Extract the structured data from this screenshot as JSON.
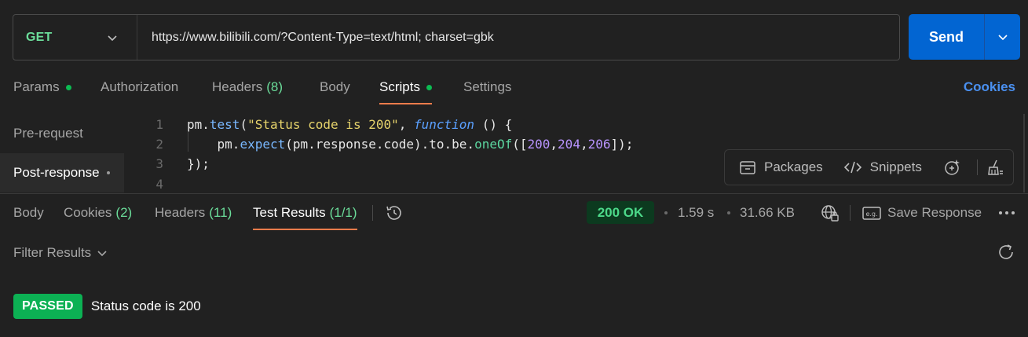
{
  "request": {
    "method": "GET",
    "url": "https://www.bilibili.com/?Content-Type=text/html; charset=gbk",
    "send_label": "Send"
  },
  "request_tabs": {
    "params": "Params",
    "authorization": "Authorization",
    "headers": "Headers",
    "headers_count": "(8)",
    "body": "Body",
    "scripts": "Scripts",
    "settings": "Settings",
    "cookies": "Cookies",
    "active": "Scripts"
  },
  "script_sidebar": {
    "pre_request": "Pre-request",
    "post_response": "Post-response",
    "active": "Post-response"
  },
  "editor": {
    "line_numbers": [
      "1",
      "2",
      "3",
      "4"
    ],
    "lines": [
      "pm.test(\"Status code is 200\", function () {",
      "    pm.expect(pm.response.code).to.be.oneOf([200,204,206]);",
      "});",
      ""
    ]
  },
  "script_tools": {
    "packages": "Packages",
    "snippets": "Snippets"
  },
  "response_tabs": {
    "body": "Body",
    "cookies": "Cookies",
    "cookies_count": "(2)",
    "headers": "Headers",
    "headers_count": "(11)",
    "test_results": "Test Results",
    "test_results_count": "(1/1)",
    "active": "Test Results"
  },
  "response_meta": {
    "status": "200 OK",
    "time": "1.59 s",
    "size": "31.66 KB",
    "save_response": "Save Response"
  },
  "filter": {
    "label": "Filter Results"
  },
  "test_results": [
    {
      "status": "PASSED",
      "name": "Status code is 200"
    }
  ],
  "colors": {
    "background": "#212121",
    "send_blue": "#0265d2",
    "active_tab_underline": "#ef7c4b",
    "passed_green": "#0cb154",
    "status_ok": "#4cd889"
  }
}
